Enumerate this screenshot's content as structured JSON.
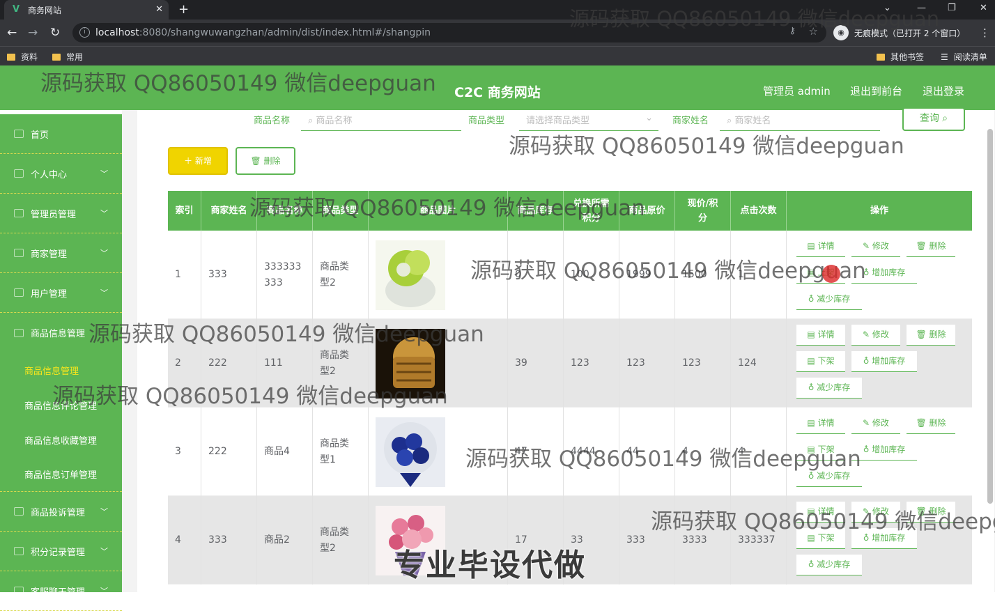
{
  "browser": {
    "tab_title": "商务网站",
    "tab_favicon": "V",
    "url_host": "localhost",
    "url_rest": ":8080/shangwuwangzhan/admin/dist/index.html#/shangpin",
    "incognito_label": "无痕模式（已打开 2 个窗口）",
    "bookmarks": [
      "资料",
      "常用"
    ],
    "bookmarks_right": [
      "其他书签",
      "阅读清单"
    ]
  },
  "header": {
    "title": "C2C 商务网站",
    "links": [
      "管理员 admin",
      "退出到前台",
      "退出登录"
    ]
  },
  "sidebar": {
    "items": [
      {
        "label": "首页",
        "chevron": false
      },
      {
        "label": "个人中心",
        "chevron": true
      },
      {
        "label": "管理员管理",
        "chevron": true
      },
      {
        "label": "商家管理",
        "chevron": true
      },
      {
        "label": "用户管理",
        "chevron": true
      },
      {
        "label": "商品信息管理",
        "chevron": true
      }
    ],
    "sub_items": [
      "商品信息管理",
      "商品信息评论管理",
      "商品信息收藏管理",
      "商品信息订单管理"
    ],
    "items_after": [
      {
        "label": "商品投诉管理",
        "chevron": true
      },
      {
        "label": "积分记录管理",
        "chevron": true
      },
      {
        "label": "客服聊天管理",
        "chevron": true
      }
    ]
  },
  "filters": {
    "name_label": "商品名称",
    "name_placeholder": "商品名称",
    "type_label": "商品类型",
    "type_placeholder": "请选择商品类型",
    "merchant_label": "商家姓名",
    "merchant_placeholder": "商家姓名",
    "query_button": "查询"
  },
  "actions": {
    "add": "新增",
    "delete": "删除"
  },
  "table": {
    "headers": [
      "索引",
      "商家姓名",
      "商品名称",
      "商品类型",
      "商品图片",
      "商品库存",
      "兑换所需积分",
      "商品原价",
      "现价/积分",
      "点击次数",
      "操作"
    ],
    "rows": [
      {
        "index": "1",
        "merchant": "333",
        "name": "333333333",
        "type": "商品类型2",
        "stock": "0",
        "points": "100",
        "orig": "1999",
        "price": "1500",
        "clicks": "1",
        "image": "green-cat",
        "shelf": "上架"
      },
      {
        "index": "2",
        "merchant": "222",
        "name": "111",
        "type": "商品类型2",
        "stock": "39",
        "points": "123",
        "orig": "123",
        "price": "123",
        "clicks": "124",
        "image": "bamboo-basket",
        "shelf": "下架"
      },
      {
        "index": "3",
        "merchant": "222",
        "name": "商品4",
        "type": "商品类型1",
        "stock": "47",
        "points": "4444",
        "orig": "44",
        "price": "4",
        "clicks": "4",
        "image": "blue-bouquet",
        "shelf": "下架"
      },
      {
        "index": "4",
        "merchant": "333",
        "name": "商品2",
        "type": "商品类型2",
        "stock": "17",
        "points": "33",
        "orig": "333",
        "price": "3333",
        "clicks": "333337",
        "image": "pink-bouquet",
        "shelf": "下架"
      }
    ],
    "op_labels": {
      "detail": "详情",
      "edit": "修改",
      "delete": "删除",
      "add_stock": "增加库存",
      "reduce_stock": "减少库存"
    }
  },
  "watermarks": {
    "text": "源码获取 QQ86050149 微信deepguan",
    "banner": "专业毕设代做"
  },
  "colors": {
    "primary": "#5cb553",
    "accent": "#f0d400"
  }
}
